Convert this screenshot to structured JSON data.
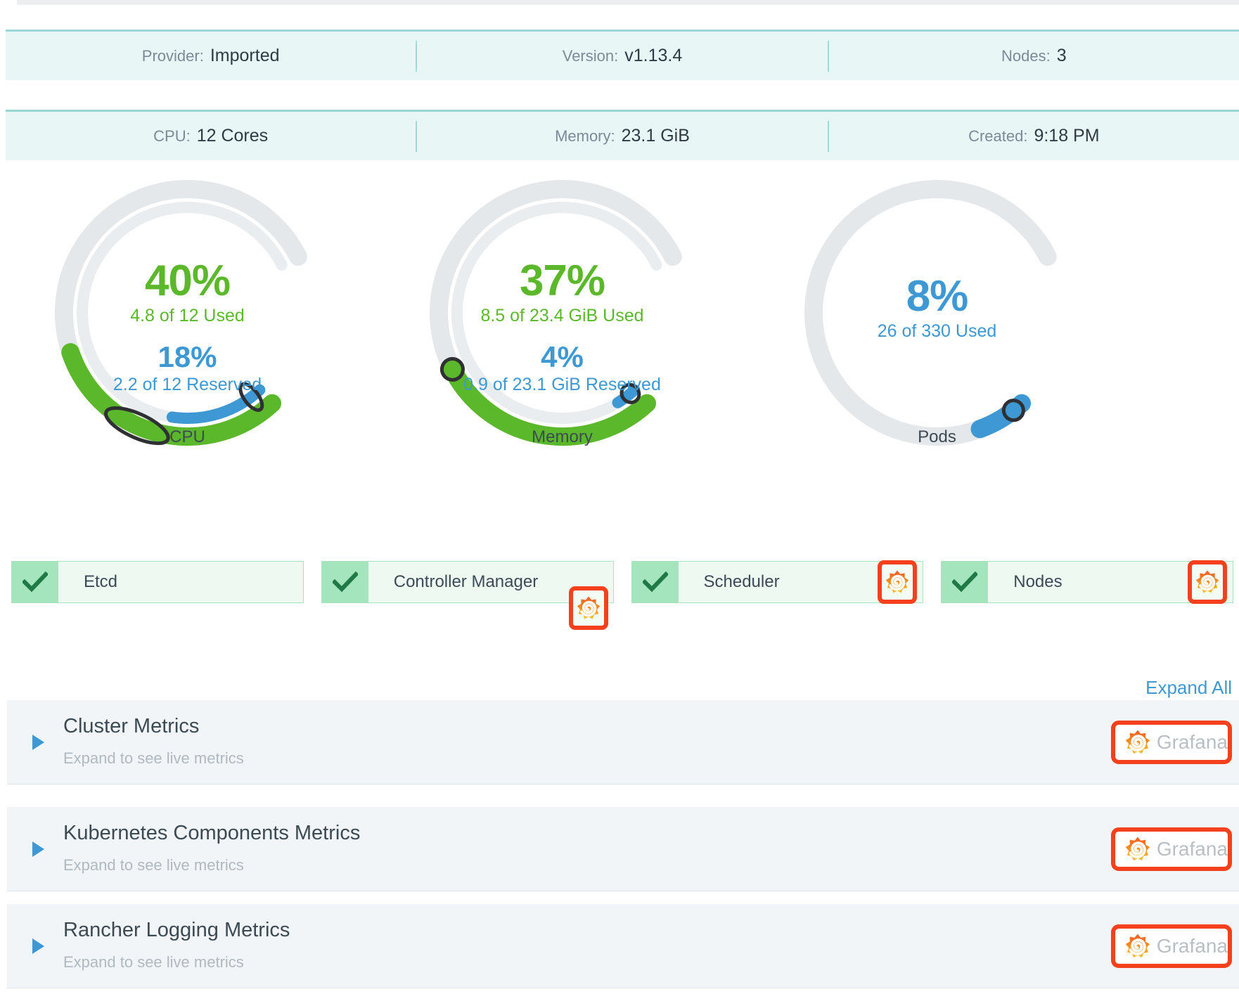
{
  "info_rows": [
    [
      {
        "label": "Provider:",
        "value": "Imported"
      },
      {
        "label": "Version:",
        "value": "v1.13.4"
      },
      {
        "label": "Nodes:",
        "value": "3"
      }
    ],
    [
      {
        "label": "CPU:",
        "value": "12 Cores"
      },
      {
        "label": "Memory:",
        "value": "23.1 GiB"
      },
      {
        "label": "Created:",
        "value": "9:18 PM"
      }
    ]
  ],
  "gauges": [
    {
      "name": "CPU",
      "used_percent": "40%",
      "used_label": "4.8 of 12 Used",
      "used_value": 40,
      "reserved_percent": "18%",
      "reserved_label": "2.2 of 12 Reserved",
      "reserved_value": 18,
      "has_reserved": true
    },
    {
      "name": "Memory",
      "used_percent": "37%",
      "used_label": "8.5 of 23.4 GiB Used",
      "used_value": 37,
      "reserved_percent": "4%",
      "reserved_label": "0.9 of 23.1 GiB Reserved",
      "reserved_value": 4,
      "has_reserved": true
    },
    {
      "name": "Pods",
      "used_percent": "8%",
      "used_label": "26 of 330 Used",
      "used_value": 8,
      "reserved_percent": "",
      "reserved_label": "",
      "reserved_value": 0,
      "has_reserved": false
    }
  ],
  "components": [
    {
      "label": "Etcd",
      "status_icon": "check-icon",
      "has_grafana": false,
      "grafana_pos": ""
    },
    {
      "label": "Controller Manager",
      "status_icon": "check-icon",
      "has_grafana": true,
      "grafana_pos": "pos-inner"
    },
    {
      "label": "Scheduler",
      "status_icon": "check-icon",
      "has_grafana": true,
      "grafana_pos": "pos-edge"
    },
    {
      "label": "Nodes",
      "status_icon": "check-icon",
      "has_grafana": true,
      "grafana_pos": "pos-edge"
    }
  ],
  "expand_all_label": "Expand All",
  "accordions": [
    {
      "title": "Cluster Metrics",
      "subtitle": "Expand to see live metrics",
      "grafana_label": "Grafana"
    },
    {
      "title": "Kubernetes Components Metrics",
      "subtitle": "Expand to see live metrics",
      "grafana_label": "Grafana"
    },
    {
      "title": "Rancher Logging Metrics",
      "subtitle": "Expand to see live metrics",
      "grafana_label": "Grafana"
    }
  ],
  "colors": {
    "used_green": "#5cb82b",
    "reserved_blue": "#3d98d3",
    "track_gray": "#e4e8ea",
    "banner_bg": "#e9f6f6",
    "banner_border": "#9cd5d5",
    "component_ok": "#a5e5bd",
    "highlight_red": "#f4401c",
    "grafana_orange": "#f05a28"
  }
}
